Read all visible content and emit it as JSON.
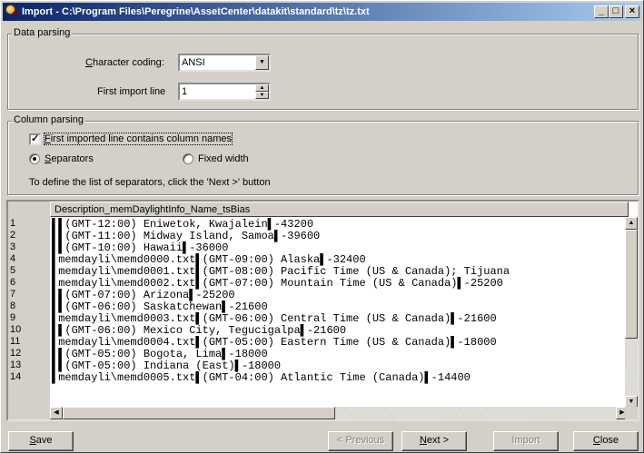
{
  "window": {
    "title": "Import - C:\\Program Files\\Peregrine\\AssetCenter\\datakit\\standard\\tz\\tz.txt",
    "min_glyph": "_",
    "max_glyph": "□",
    "close_glyph": "×"
  },
  "data_parsing": {
    "group_label": "Data parsing",
    "coding_label": "Character coding:",
    "coding_value": "ANSI",
    "first_line_label": "First import line",
    "first_line_value": "1"
  },
  "column_parsing": {
    "group_label": "Column parsing",
    "first_line_names_label": "First imported line contains column names",
    "first_line_names_checked": true,
    "separators_label": "Separators",
    "separators_selected": true,
    "fixed_width_label": "Fixed width",
    "fixed_width_selected": false,
    "hint": "To define the list of separators, click the 'Next >' button"
  },
  "preview": {
    "column_header": "Description_memDaylightInfo_Name_tsBias",
    "row_numbers": [
      "1",
      "2",
      "3",
      "4",
      "5",
      "6",
      "7",
      "8",
      "9",
      "10",
      "11",
      "12",
      "13",
      "14"
    ],
    "lines": [
      "▌▌(GMT-12:00) Eniwetok, Kwajalein▌-43200",
      "▌▌(GMT-11:00) Midway Island, Samoa▌-39600",
      "▌▌(GMT-10:00) Hawaii▌-36000",
      "▌memdayli\\memd0000.txt▌(GMT-09:00) Alaska▌-32400",
      "▌memdayli\\memd0001.txt▌(GMT-08:00) Pacific Time (US & Canada); Tijuana",
      "▌memdayli\\memd0002.txt▌(GMT-07:00) Mountain Time (US & Canada)▌-25200",
      "▌▌(GMT-07:00) Arizona▌-25200",
      "▌▌(GMT-06:00) Saskatchewan▌-21600",
      "▌memdayli\\memd0003.txt▌(GMT-06:00) Central Time (US & Canada)▌-21600",
      "▌▌(GMT-06:00) Mexico City, Tegucigalpa▌-21600",
      "▌memdayli\\memd0004.txt▌(GMT-05:00) Eastern Time (US & Canada)▌-18000",
      "▌▌(GMT-05:00) Bogota, Lima▌-18000",
      "▌▌(GMT-05:00) Indiana (East)▌-18000",
      "▌memdayli\\memd0005.txt▌(GMT-04:00) Atlantic Time (Canada)▌-14400"
    ]
  },
  "buttons": {
    "save": "Save",
    "previous": "< Previous",
    "next": "Next >",
    "import": "Import",
    "close": "Close"
  },
  "icons": {
    "app": "magnifier-icon",
    "dropdown": "chevron-down-icon",
    "spin": "spin-arrows-icon"
  }
}
